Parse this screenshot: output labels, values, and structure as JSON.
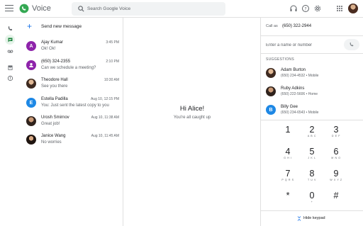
{
  "app": {
    "title": "Voice"
  },
  "search": {
    "placeholder": "Search Google Voice"
  },
  "topbar_icons": [
    "headset-icon",
    "help-icon",
    "settings-icon",
    "apps-grid-icon"
  ],
  "rail": {
    "items": [
      "calls-icon",
      "messages-icon",
      "voicemail-icon",
      "archive-icon",
      "spam-icon"
    ],
    "active": "messages-icon"
  },
  "new_message": {
    "label": "Send new message"
  },
  "conversations": [
    {
      "name": "Ajay Kumar",
      "preview": "Ok! Ok!",
      "time": "3:45 PM",
      "initial": "A",
      "color": "#8e24aa"
    },
    {
      "name": "(650) 324-2355",
      "preview": "Can we schedule a meeting?",
      "time": "2:10 PM",
      "initial": "",
      "color": "#8e24aa"
    },
    {
      "name": "Theodore Hall",
      "preview": "See you there",
      "time": "10:30 AM",
      "initial": "",
      "color": "#6d4c41"
    },
    {
      "name": "Estella Padilla",
      "preview": "You: Just sent the latest copy to you",
      "time": "Aug 10, 12:15 PM",
      "initial": "E",
      "color": "#1e88e5"
    },
    {
      "name": "Urosh Smirnov",
      "preview": "Great job!",
      "time": "Aug 10, 11:38 AM",
      "initial": "",
      "color": "#5d4037"
    },
    {
      "name": "Janice Wang",
      "preview": "No worries",
      "time": "Aug 10, 11:45 AM",
      "initial": "",
      "color": "#4e342e"
    }
  ],
  "center": {
    "greeting": "Hi Alice!",
    "status": "You're all caught up"
  },
  "call_as": {
    "label": "Call as",
    "number": "(650) 322-2944"
  },
  "dial_input": {
    "placeholder": "Enter a name or number"
  },
  "suggestions": {
    "label": "SUGGESTIONS",
    "items": [
      {
        "name": "Adam Burton",
        "detail": "(650) 234-4532 • Mobile",
        "initial": "",
        "color": "#6d4c41"
      },
      {
        "name": "Ruby Adkins",
        "detail": "(650) 222-5606 • Home",
        "initial": "",
        "color": "#5d4037"
      },
      {
        "name": "Billy Gee",
        "detail": "(650) 234-6543 • Mobile",
        "initial": "B",
        "color": "#1e88e5"
      }
    ]
  },
  "keypad": [
    {
      "digit": "1",
      "letters": ""
    },
    {
      "digit": "2",
      "letters": "A B C"
    },
    {
      "digit": "3",
      "letters": "D E F"
    },
    {
      "digit": "4",
      "letters": "G H I"
    },
    {
      "digit": "5",
      "letters": "J K L"
    },
    {
      "digit": "6",
      "letters": "M N O"
    },
    {
      "digit": "7",
      "letters": "P Q R S"
    },
    {
      "digit": "8",
      "letters": "T U V"
    },
    {
      "digit": "9",
      "letters": "W X Y Z"
    },
    {
      "digit": "*",
      "letters": ""
    },
    {
      "digit": "0",
      "letters": "+"
    },
    {
      "digit": "#",
      "letters": ""
    }
  ],
  "hide_keypad": {
    "label": "Hide keypad"
  },
  "colors": {
    "accent": "#1a73e8",
    "brand_green": "#34a853",
    "active_rail": "#e6f4ea"
  }
}
